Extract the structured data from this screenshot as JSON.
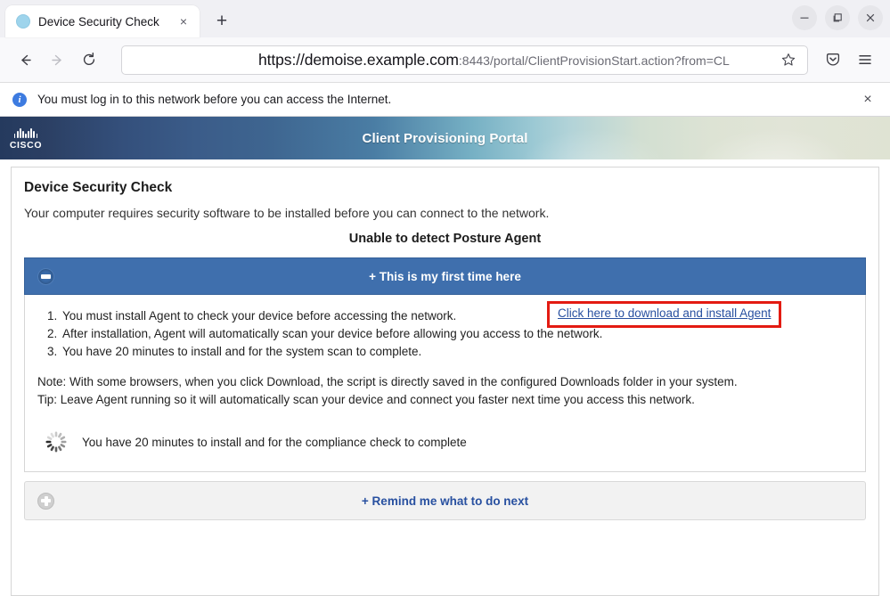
{
  "browser": {
    "tab": {
      "title": "Device Security Check",
      "favicon_name": "page-favicon",
      "close_label": "×"
    },
    "newtab_label": "+",
    "window_controls": {
      "minimize": "—",
      "maximize": "❐",
      "close": "×"
    },
    "nav": {
      "back": "←",
      "forward": "→",
      "reload": "↻"
    },
    "url": {
      "host": "https://demoise.example.com",
      "path": ":8443/portal/ClientProvisionStart.action?from=CL",
      "bookmark_star": "☆"
    },
    "toolbar": {
      "pocket": "save-to-pocket",
      "menu": "☰"
    },
    "notification": {
      "icon": "i",
      "text": "You must log in to this network before you can access the Internet.",
      "close": "×"
    }
  },
  "portal": {
    "banner": {
      "brand": "CISCO",
      "title": "Client Provisioning Portal"
    },
    "heading": "Device Security Check",
    "subtitle": "Your computer requires security software to be installed before you can connect to the network.",
    "status_message": "Unable to detect Posture Agent",
    "accordion_open": {
      "title": "+ This is my first time here",
      "toggle_icon": "minus-circle-icon",
      "steps": [
        "You must install Agent to check your device before accessing the network.",
        "After installation, Agent will automatically scan your device before allowing you access to the network.",
        "You have 20 minutes to install and for the system scan to complete."
      ],
      "download_link": "Click here to download and install Agent",
      "note": "Note: With some browsers, when you click Download, the script is directly saved in the configured Downloads folder in your system.",
      "tip": "Tip: Leave Agent running so it will automatically scan your device and connect you faster next time you access this network.",
      "spinner_text": "You have 20 minutes to install and for the compliance check to complete"
    },
    "accordion_closed": {
      "title": "+ Remind me what to do next",
      "toggle_icon": "plus-circle-icon"
    }
  },
  "colors": {
    "accent_blue": "#3f6fad",
    "link_blue": "#2850a0",
    "highlight_red": "#e31b12",
    "banner_dark": "#253a5e",
    "banner_light": "#dfe3d3"
  }
}
